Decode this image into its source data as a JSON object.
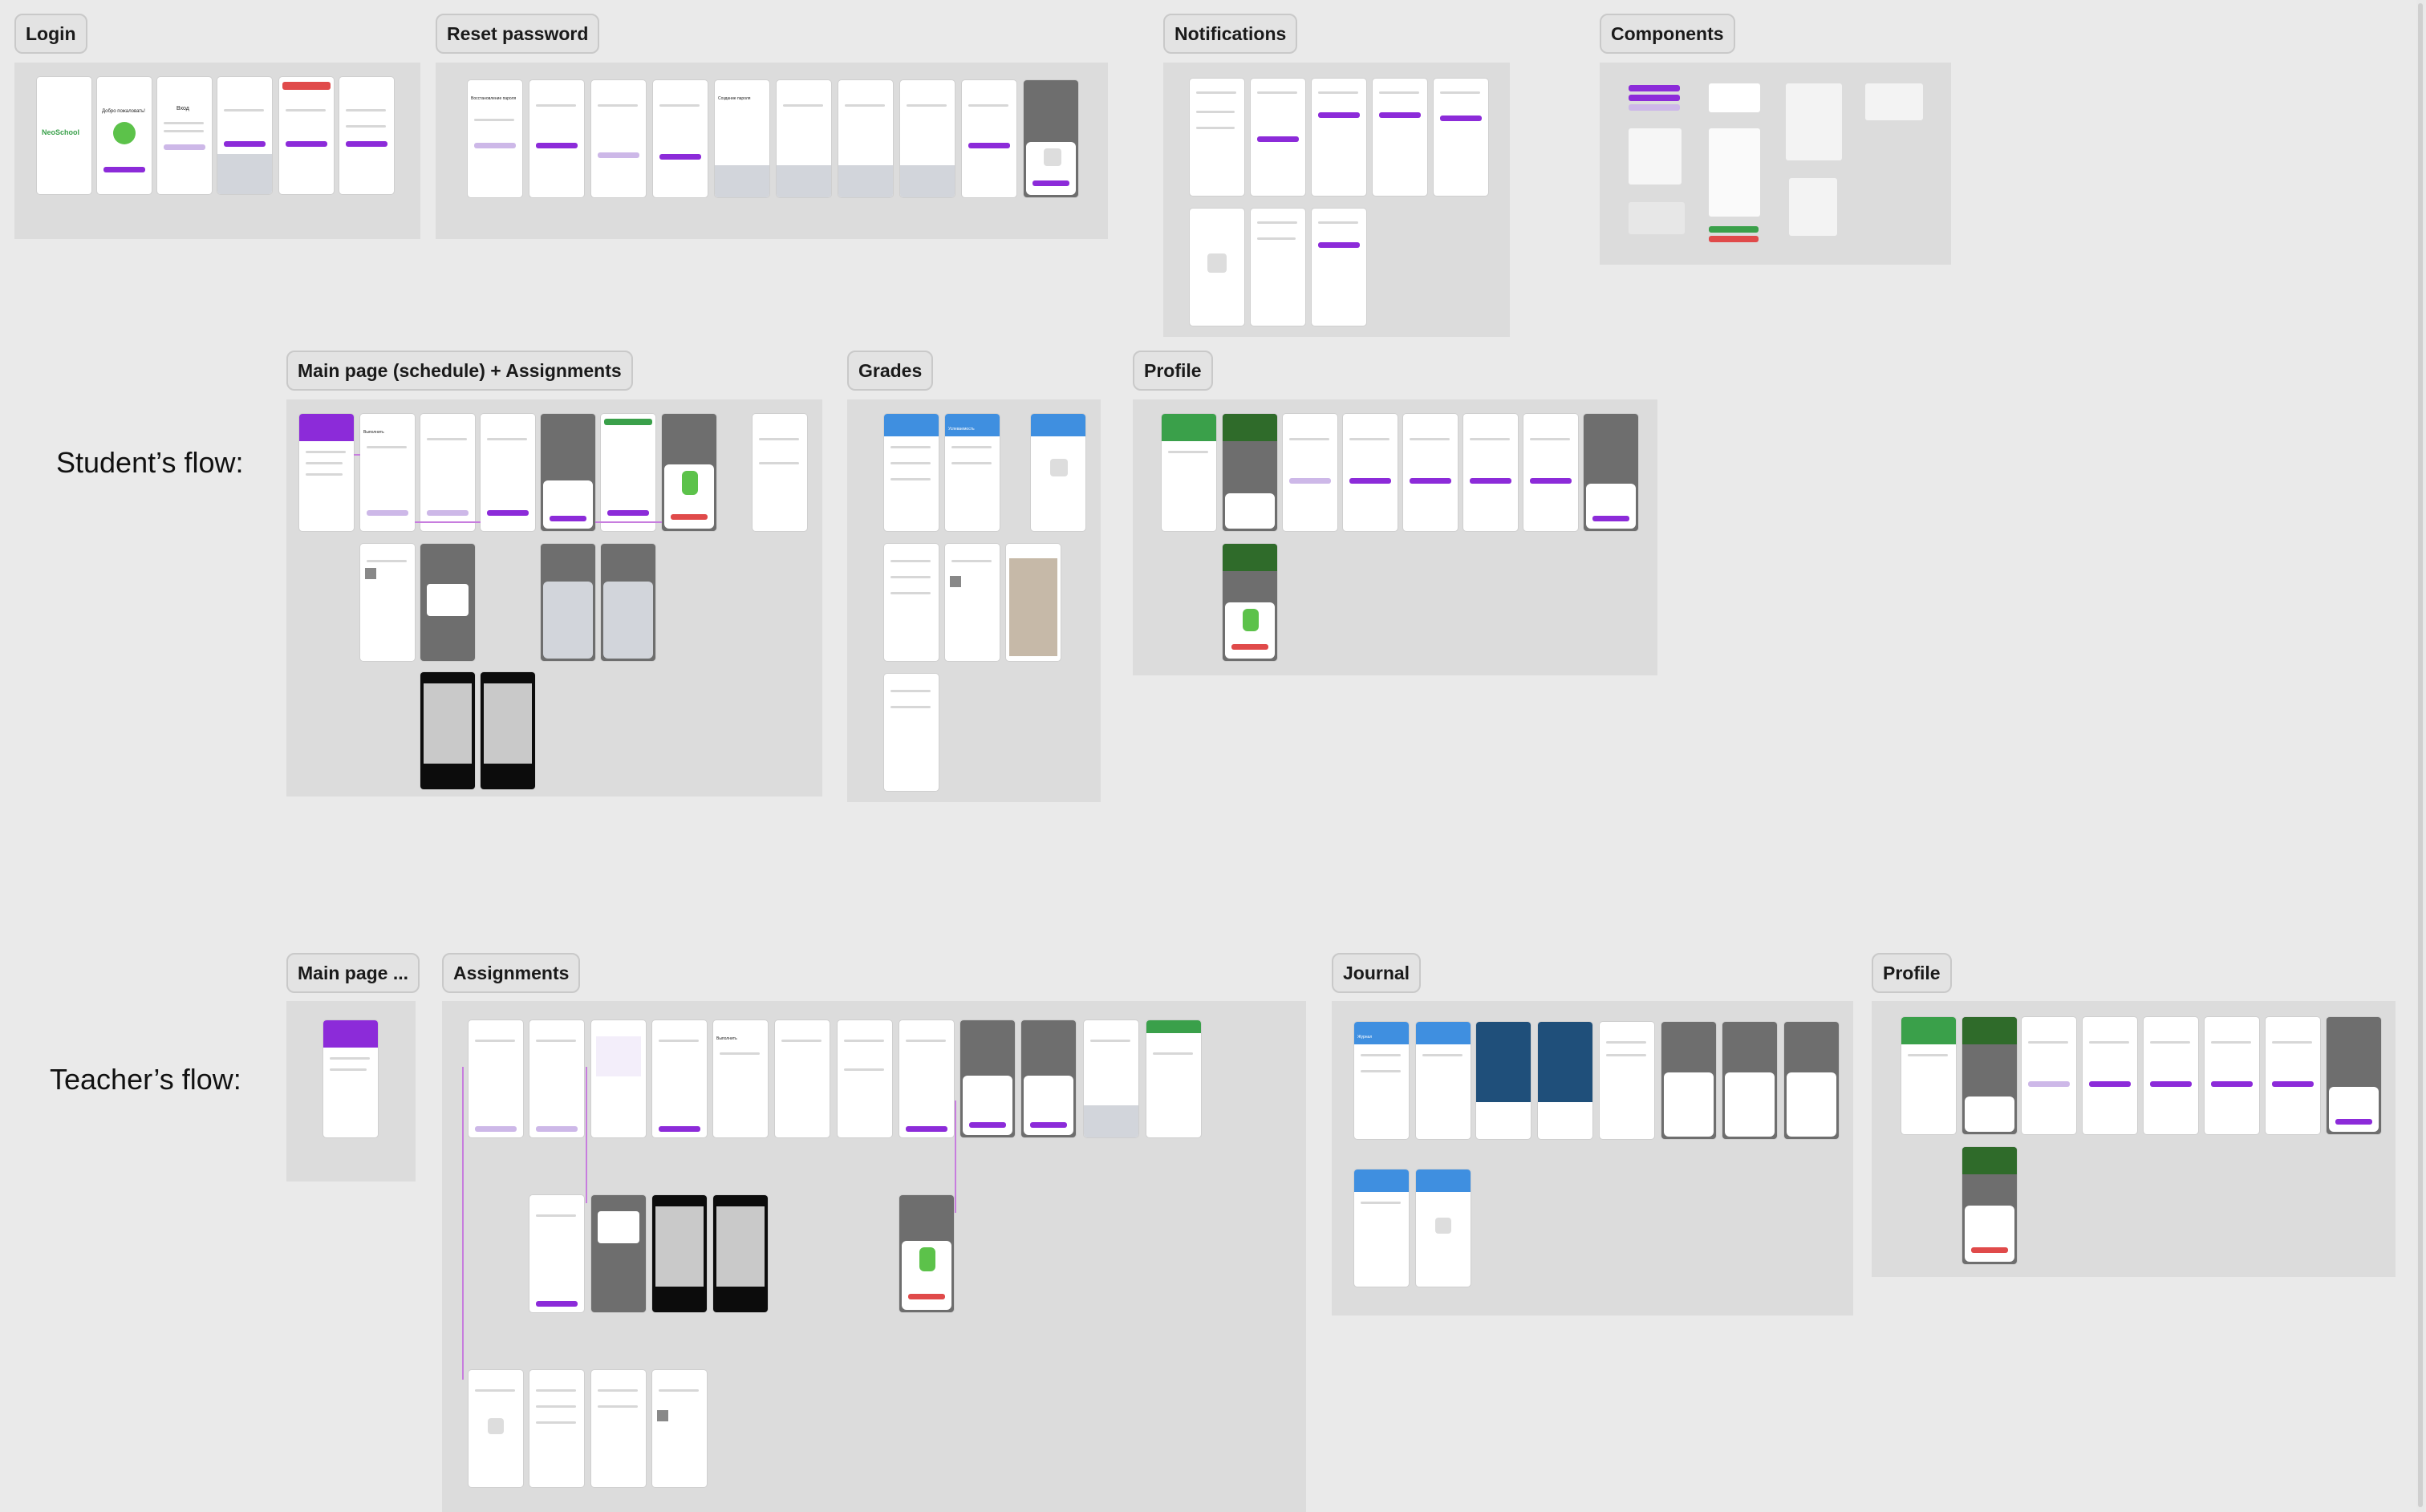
{
  "sections": {
    "login": "Login",
    "reset_password": "Reset password",
    "notifications": "Notifications",
    "components": "Components",
    "student_main": "Main page (schedule) + Assignments",
    "student_grades": "Grades",
    "student_profile": "Profile",
    "teacher_main": "Main page ...",
    "teacher_assignments": "Assignments",
    "teacher_journal": "Journal",
    "teacher_profile": "Profile"
  },
  "flows": {
    "student": "Student’s flow:",
    "teacher": "Teacher’s flow:"
  },
  "screen_text": {
    "login_logo": "NeoSchool",
    "login_welcome": "Добро пожаловать!",
    "login_title": "Вход",
    "reset_title": "Восстановление пароля",
    "new_password": "Создание пароля",
    "assignment": "Выполнить",
    "journal": "Журнал",
    "grades": "Успеваемость"
  },
  "colors": {
    "canvas": "#eaeaea",
    "section": "#dcdcdc",
    "purple": "#8c2bd9",
    "light_purple": "#cdb8e8",
    "blue": "#3f8fe0",
    "dark_blue": "#1f4f7a",
    "green": "#3aa04a",
    "dark_green": "#2f6b2a",
    "red": "#e04a4a",
    "connector": "#c77dde"
  }
}
